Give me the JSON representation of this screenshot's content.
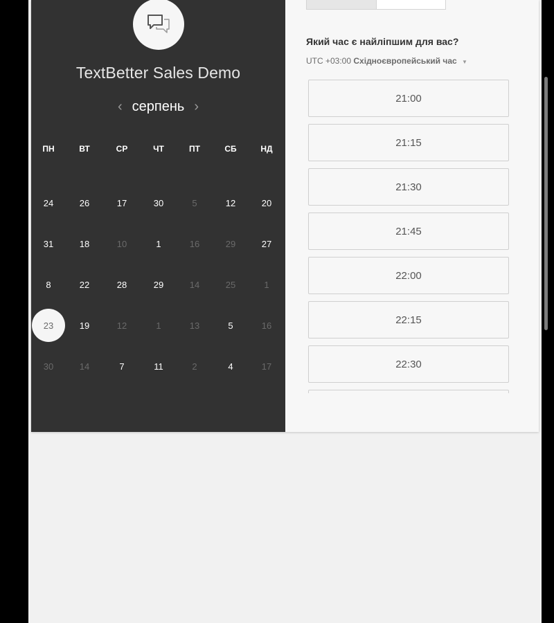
{
  "header": {
    "title": "TextBetter Sales Demo"
  },
  "calendar": {
    "month": "серпень",
    "prev_arrow": "‹",
    "next_arrow": "›",
    "weekdays": [
      "ПН",
      "ВТ",
      "СР",
      "ЧТ",
      "ПТ",
      "СБ",
      "НД"
    ],
    "weeks": [
      [
        {
          "d": "24",
          "m": false
        },
        {
          "d": "26",
          "m": false
        },
        {
          "d": "17",
          "m": false
        },
        {
          "d": "30",
          "m": false
        },
        {
          "d": "5",
          "m": true
        },
        {
          "d": "12",
          "m": false
        },
        {
          "d": "20",
          "m": false
        }
      ],
      [
        {
          "d": "31",
          "m": false
        },
        {
          "d": "18",
          "m": false
        },
        {
          "d": "10",
          "m": true
        },
        {
          "d": "1",
          "m": false
        },
        {
          "d": "16",
          "m": true
        },
        {
          "d": "29",
          "m": true
        },
        {
          "d": "27",
          "m": false
        }
      ],
      [
        {
          "d": "8",
          "m": false
        },
        {
          "d": "22",
          "m": false
        },
        {
          "d": "28",
          "m": false
        },
        {
          "d": "29",
          "m": false
        },
        {
          "d": "14",
          "m": true
        },
        {
          "d": "25",
          "m": true
        },
        {
          "d": "1",
          "m": true
        }
      ],
      [
        {
          "d": "23",
          "m": false,
          "selected": true
        },
        {
          "d": "19",
          "m": false
        },
        {
          "d": "12",
          "m": true
        },
        {
          "d": "1",
          "m": true
        },
        {
          "d": "13",
          "m": true
        },
        {
          "d": "5",
          "m": false
        },
        {
          "d": "16",
          "m": true
        }
      ],
      [
        {
          "d": "30",
          "m": true
        },
        {
          "d": "14",
          "m": true
        },
        {
          "d": "7",
          "m": false
        },
        {
          "d": "11",
          "m": false
        },
        {
          "d": "2",
          "m": true
        },
        {
          "d": "4",
          "m": false
        },
        {
          "d": "17",
          "m": true
        }
      ]
    ]
  },
  "right": {
    "question": "Який час є найліпшим для вас?",
    "timezone_offset": "UTC +03:00",
    "timezone_name": "Східноєвропейський час",
    "timezone_caret": "▼",
    "slots": [
      "21:00",
      "21:15",
      "21:30",
      "21:45",
      "22:00",
      "22:15",
      "22:30",
      ""
    ]
  },
  "colors": {
    "left_panel": "#323232",
    "right_panel": "#f7f7f7",
    "page": "#f1f1f1"
  }
}
